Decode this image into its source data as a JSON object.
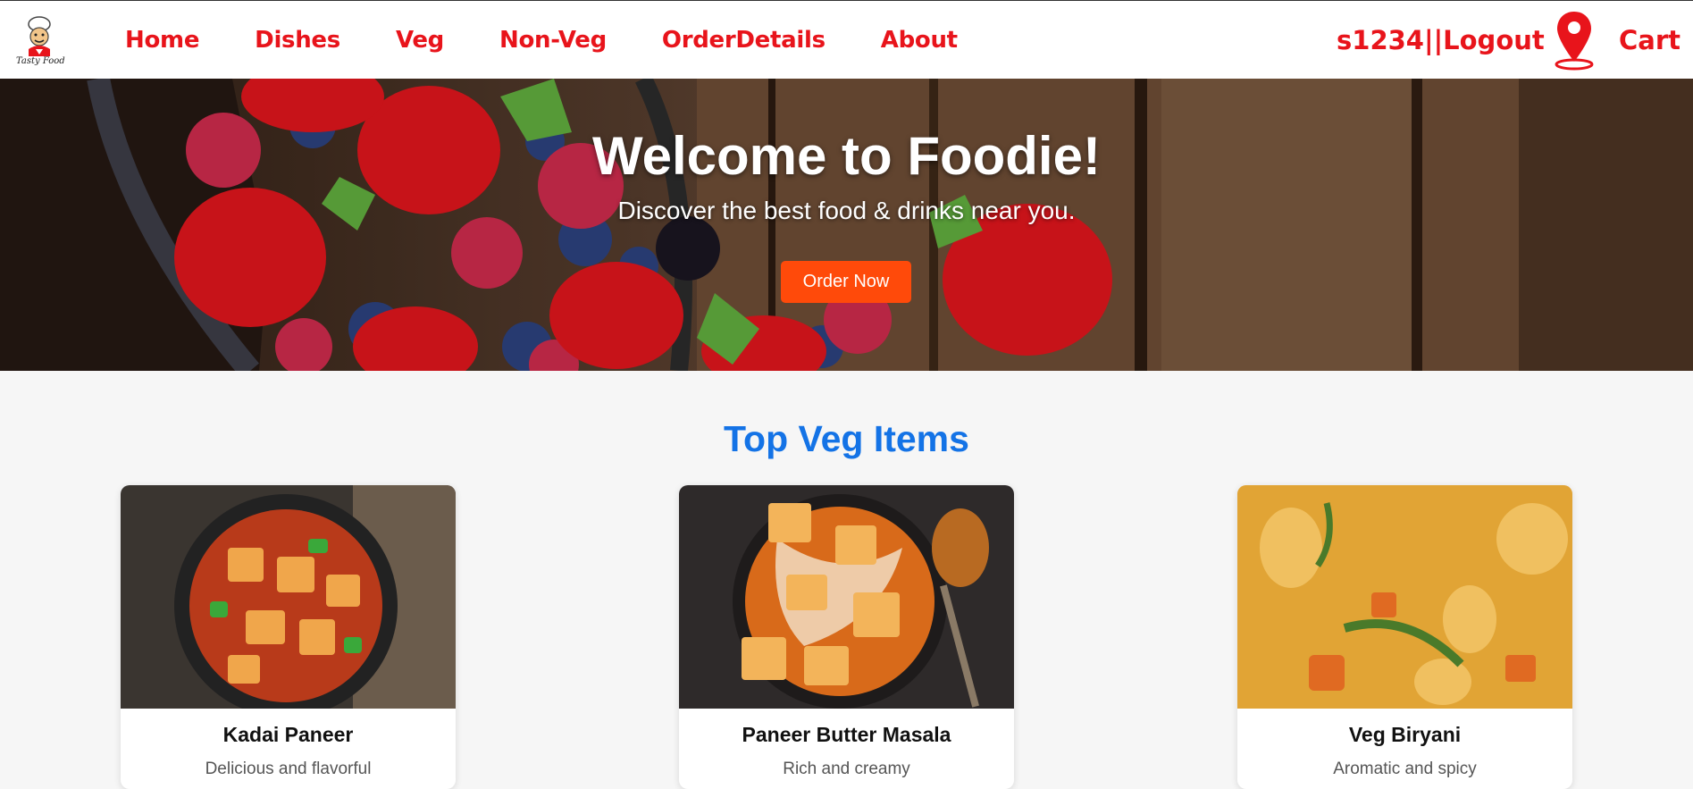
{
  "navbar": {
    "logo_icon": "chef-logo-icon",
    "logo_text": "Tasty Food",
    "links": [
      {
        "label": "Home"
      },
      {
        "label": "Dishes"
      },
      {
        "label": "Veg"
      },
      {
        "label": "Non-Veg"
      },
      {
        "label": "OrderDetails"
      },
      {
        "label": "About"
      }
    ],
    "user_logout": "s1234||Logout",
    "location_icon": "map-pin-icon",
    "cart_label": "Cart",
    "link_color": "#e8141b"
  },
  "hero": {
    "title": "Welcome to Foodie!",
    "subtitle": "Discover the best food & drinks near you.",
    "button_label": "Order Now",
    "button_color": "#ff4a0a"
  },
  "section": {
    "title": "Top Veg Items",
    "title_color": "#1473e6",
    "cards": [
      {
        "name": "Kadai Paneer",
        "desc": "Delicious and flavorful"
      },
      {
        "name": "Paneer Butter Masala",
        "desc": "Rich and creamy"
      },
      {
        "name": "Veg Biryani",
        "desc": "Aromatic and spicy"
      }
    ]
  }
}
